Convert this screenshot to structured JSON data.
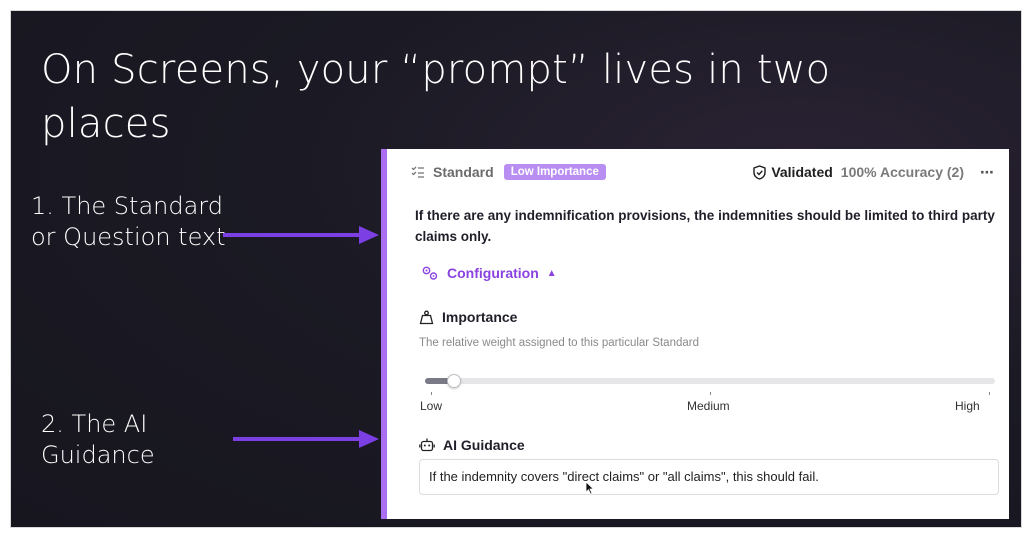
{
  "slide": {
    "title": "On Screens, your “prompt” lives in two places",
    "annotation_1": "1. The Standard or Question text",
    "annotation_2": "2. The AI Guidance"
  },
  "panel": {
    "header": {
      "icon": "checklist-icon",
      "label": "Standard",
      "badge": "Low Importance",
      "validated_icon": "shield-check-icon",
      "validated": "Validated",
      "accuracy": "100% Accuracy (2)",
      "more": "⋯"
    },
    "standard_text": "If there are any indemnification provisions, the indemnities should be limited to third party claims only.",
    "configuration": {
      "label": "Configuration",
      "caret": "▲",
      "icon": "gears-icon"
    },
    "importance": {
      "title": "Importance",
      "icon": "weight-icon",
      "description": "The relative weight assigned to this particular Standard",
      "value": 0.05,
      "labels": [
        "Low",
        "Medium",
        "High"
      ]
    },
    "ai_guidance": {
      "title": "AI Guidance",
      "icon": "robot-icon",
      "value": "If the indemnity covers \"direct claims\" or \"all claims\", this should fail."
    }
  },
  "colors": {
    "accent": "#8a43e0",
    "badge": "#b98ef2",
    "panel_border": "#a96ff0",
    "arrow": "#7b3fe4",
    "slide_bg": "#1b1a24"
  }
}
